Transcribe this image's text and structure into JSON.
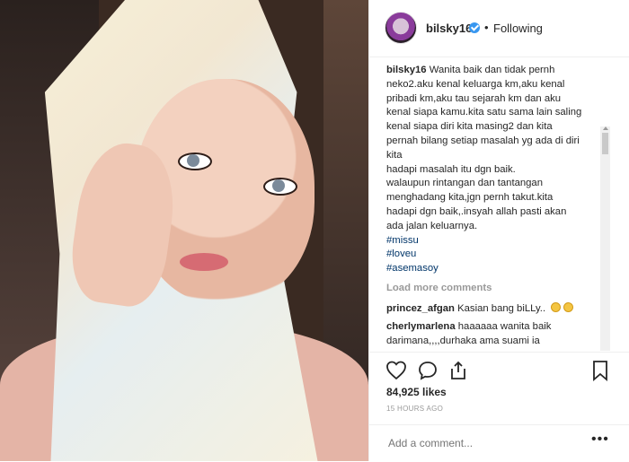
{
  "post": {
    "username": "bilsky16",
    "follow_status": "Following",
    "separator": "•",
    "verified": true
  },
  "caption": {
    "username": "bilsky16",
    "lines": [
      "Wanita baik dan tidak pernh",
      "neko2.aku kenal keluarga km,aku kenal",
      "pribadi km,aku tau sejarah km dan aku",
      "kenal siapa kamu.kita satu sama lain saling",
      "kenal siapa diri kita masing2 dan kita",
      "pernah bilang setiap masalah yg ada di diri",
      "kita",
      "hadapi masalah itu dgn baik.",
      "walaupun rintangan dan tantangan",
      "menghadang kita,jgn pernh takut.kita",
      "hadapi dgn baik,.insyah allah pasti akan",
      "ada jalan keluarnya."
    ],
    "hashtags": [
      "#missu",
      "#loveu",
      "#asemasoy"
    ]
  },
  "comments": {
    "load_more": "Load more comments",
    "items": [
      {
        "username": "princez_afgan",
        "text": "Kasian bang biLLy.."
      },
      {
        "username": "cherlymarlena",
        "text": "haaaaaa wanita baik darimana,,,,durhaka ama suami ia"
      }
    ]
  },
  "actions": {
    "likes": "84,925 likes",
    "timestamp": "15 HOURS AGO"
  },
  "add_comment": {
    "placeholder": "Add a comment..."
  },
  "icons": {
    "like": "heart-icon",
    "comment": "comment-icon",
    "share": "share-icon",
    "save": "bookmark-icon",
    "more": "more-options-icon",
    "verified": "verified-badge-icon"
  },
  "colors": {
    "text": "#262626",
    "secondary": "#999999",
    "link": "#003569",
    "verified": "#3897f0"
  }
}
